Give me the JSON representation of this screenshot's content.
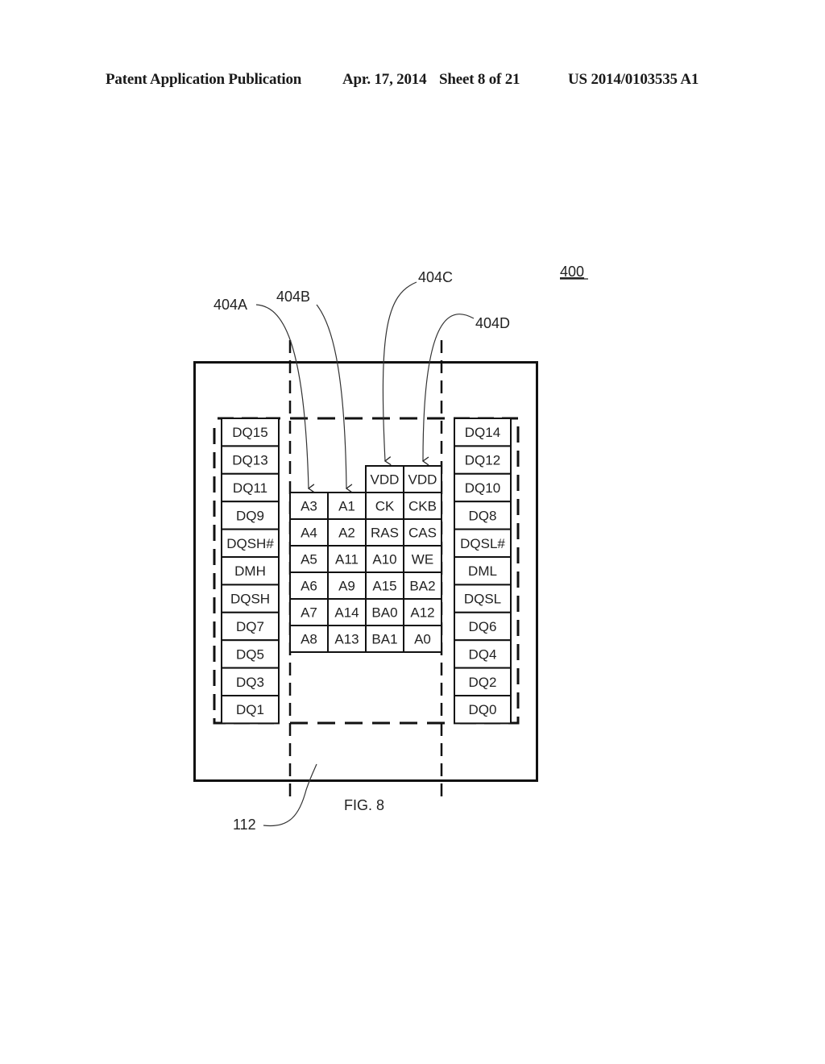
{
  "header": {
    "publication": "Patent Application Publication",
    "date": "Apr. 17, 2014",
    "sheet": "Sheet 8 of 21",
    "number": "US 2014/0103535 A1"
  },
  "figure": {
    "caption": "FIG. 8",
    "ref_main": "400",
    "ref_substrate": "112",
    "callouts": [
      "404A",
      "404B",
      "404C",
      "404D"
    ],
    "left_column": [
      "DQ15",
      "DQ13",
      "DQ11",
      "DQ9",
      "DQSH#",
      "DMH",
      "DQSH",
      "DQ7",
      "DQ5",
      "DQ3",
      "DQ1"
    ],
    "right_column": [
      "DQ14",
      "DQ12",
      "DQ10",
      "DQ8",
      "DQSL#",
      "DML",
      "DQSL",
      "DQ6",
      "DQ4",
      "DQ2",
      "DQ0"
    ],
    "center_top_row": [
      "VDD",
      "VDD"
    ],
    "center_grid": [
      [
        "A3",
        "A1",
        "CK",
        "CKB"
      ],
      [
        "A4",
        "A2",
        "RAS",
        "CAS"
      ],
      [
        "A5",
        "A11",
        "A10",
        "WE"
      ],
      [
        "A6",
        "A9",
        "A15",
        "BA2"
      ],
      [
        "A7",
        "A14",
        "BA0",
        "A12"
      ],
      [
        "A8",
        "A13",
        "BA1",
        "A0"
      ]
    ]
  }
}
